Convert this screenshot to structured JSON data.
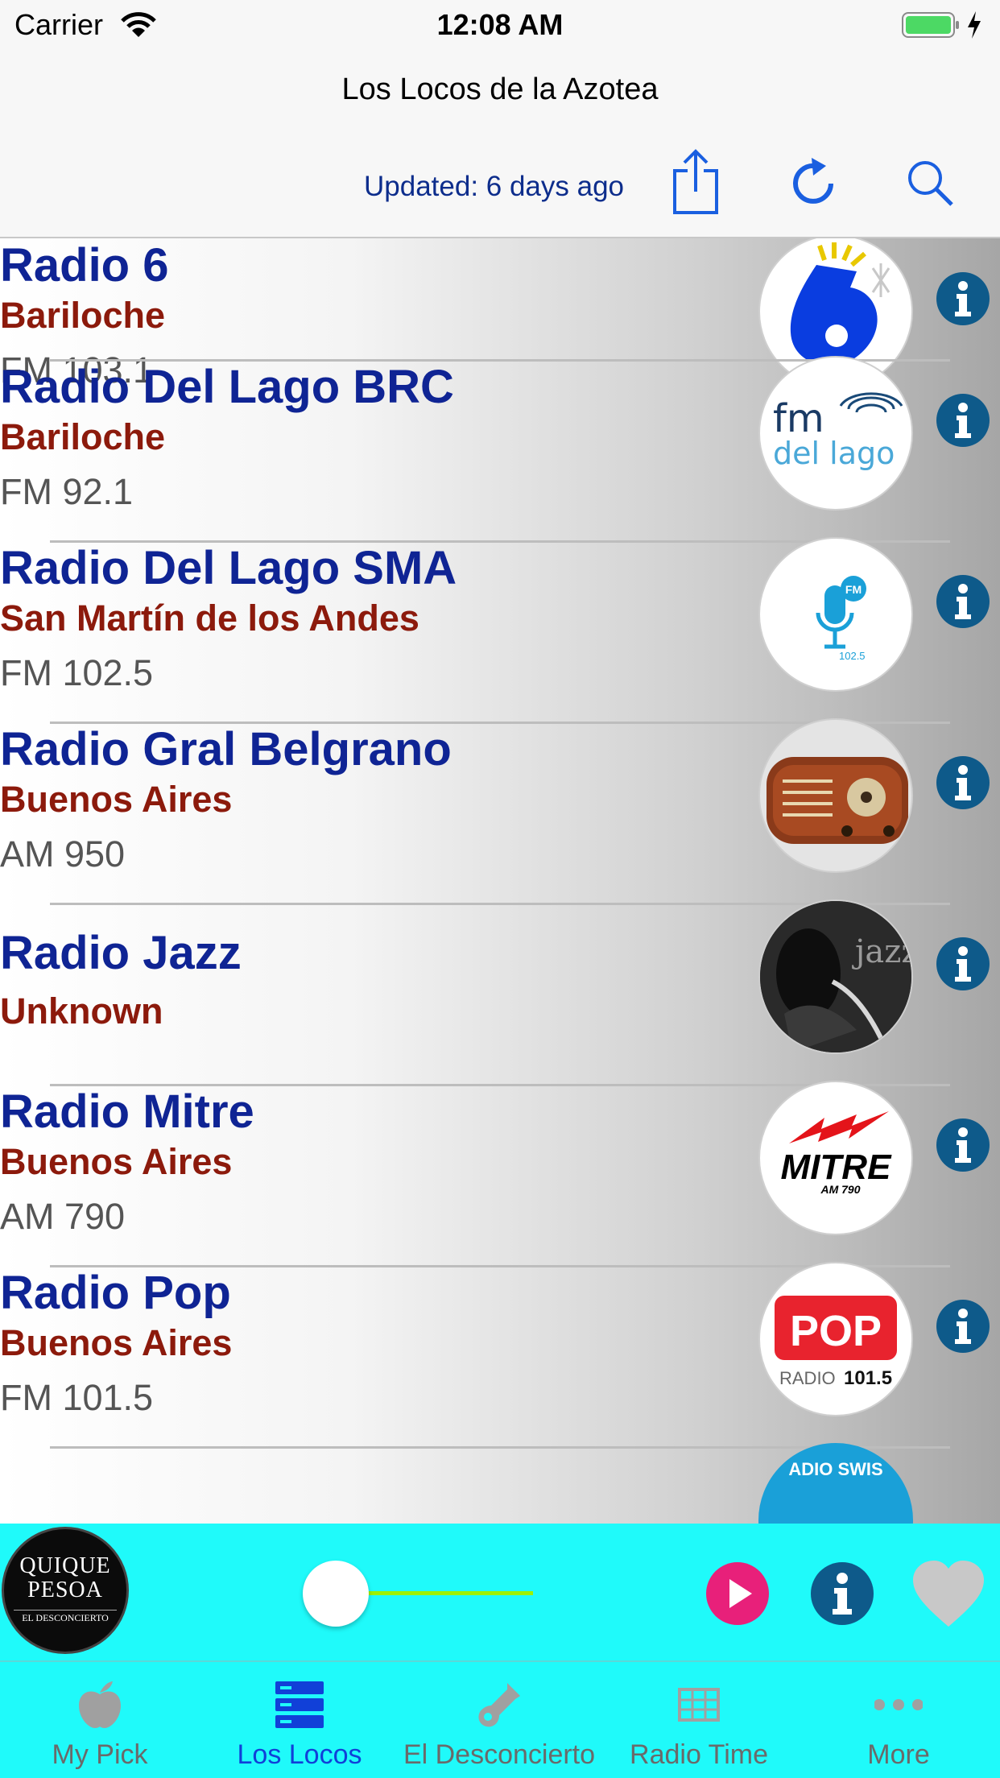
{
  "status_bar": {
    "carrier": "Carrier",
    "time": "12:08 AM"
  },
  "nav": {
    "title": "Los Locos de la Azotea",
    "updated": "Updated: 6 days ago"
  },
  "stations": [
    {
      "name": "Radio 6",
      "location": "Bariloche",
      "freq": "FM 103.1",
      "logo": "radio-6-logo"
    },
    {
      "name": "Radio Del Lago BRC",
      "location": "Bariloche",
      "freq": "FM 92.1",
      "logo": "fm-del-lago-logo"
    },
    {
      "name": "Radio Del Lago SMA",
      "location": "San Martín de los Andes",
      "freq": "FM 102.5",
      "logo": "microphone-fm-logo"
    },
    {
      "name": "Radio Gral Belgrano",
      "location": "Buenos Aires",
      "freq": "AM 950",
      "logo": "vintage-radio-logo"
    },
    {
      "name": "Radio Jazz",
      "location": "Unknown",
      "freq": "",
      "logo": "jazz-logo"
    },
    {
      "name": "Radio Mitre",
      "location": "Buenos Aires",
      "freq": "AM 790",
      "logo": "mitre-logo"
    },
    {
      "name": "Radio Pop",
      "location": "Buenos Aires",
      "freq": "FM 101.5",
      "logo": "pop-logo"
    }
  ],
  "logo_text": {
    "fm": "fm",
    "del_lago": "del lago",
    "fm_badge": "FM",
    "freq_small": "102.5",
    "jazz": "jazz",
    "mitre": "MITRE",
    "mitre_am": "AM 790",
    "pop": "POP",
    "pop_radio": "RADIO",
    "pop_freq": "101.5",
    "swiss": "ADIO SWIS"
  },
  "player": {
    "album_line1": "QUIQUE",
    "album_line2": "PESOA",
    "album_line3": "EL DESCONCIERTO",
    "progress": 0.1
  },
  "tabs": [
    {
      "label": "My Pick",
      "icon": "apple-icon"
    },
    {
      "label": "Los Locos",
      "icon": "server-stack-icon"
    },
    {
      "label": "El Desconcierto",
      "icon": "guitar-icon"
    },
    {
      "label": "Radio Time",
      "icon": "grid-table-icon"
    },
    {
      "label": "More",
      "icon": "more-dots-icon"
    }
  ],
  "colors": {
    "accent": "#1140d8",
    "player_bg": "#1ffafa",
    "station_name": "#0f2494",
    "location": "#8c1a0c",
    "info": "#0e5a8a"
  }
}
